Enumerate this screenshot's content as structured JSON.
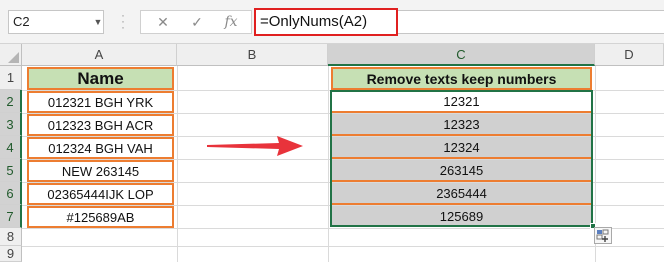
{
  "name_box": {
    "value": "C2"
  },
  "formula_bar": {
    "cancel_icon": "✕",
    "enter_icon": "✓",
    "function_icon": "fx",
    "formula": "=OnlyNums(A2)"
  },
  "columns": [
    "A",
    "B",
    "C",
    "D"
  ],
  "rows": [
    "1",
    "2",
    "3",
    "4",
    "5",
    "6",
    "7",
    "8",
    "9"
  ],
  "column_a": {
    "header": "Name",
    "values": [
      "012321 BGH YRK",
      "012323 BGH ACR",
      "012324 BGH VAH",
      "NEW 263145",
      "02365444IJK LOP",
      "#125689AB"
    ]
  },
  "column_c": {
    "header": "Remove texts keep numbers",
    "values": [
      "12321",
      "12323",
      "12324",
      "263145",
      "2365444",
      "125689"
    ]
  },
  "colors": {
    "header_fill": "#c6e0b4",
    "border_orange": "#ed7d31",
    "selection_green": "#217346",
    "selected_fill": "#d0d0d0",
    "arrow_red": "#e8333b"
  }
}
